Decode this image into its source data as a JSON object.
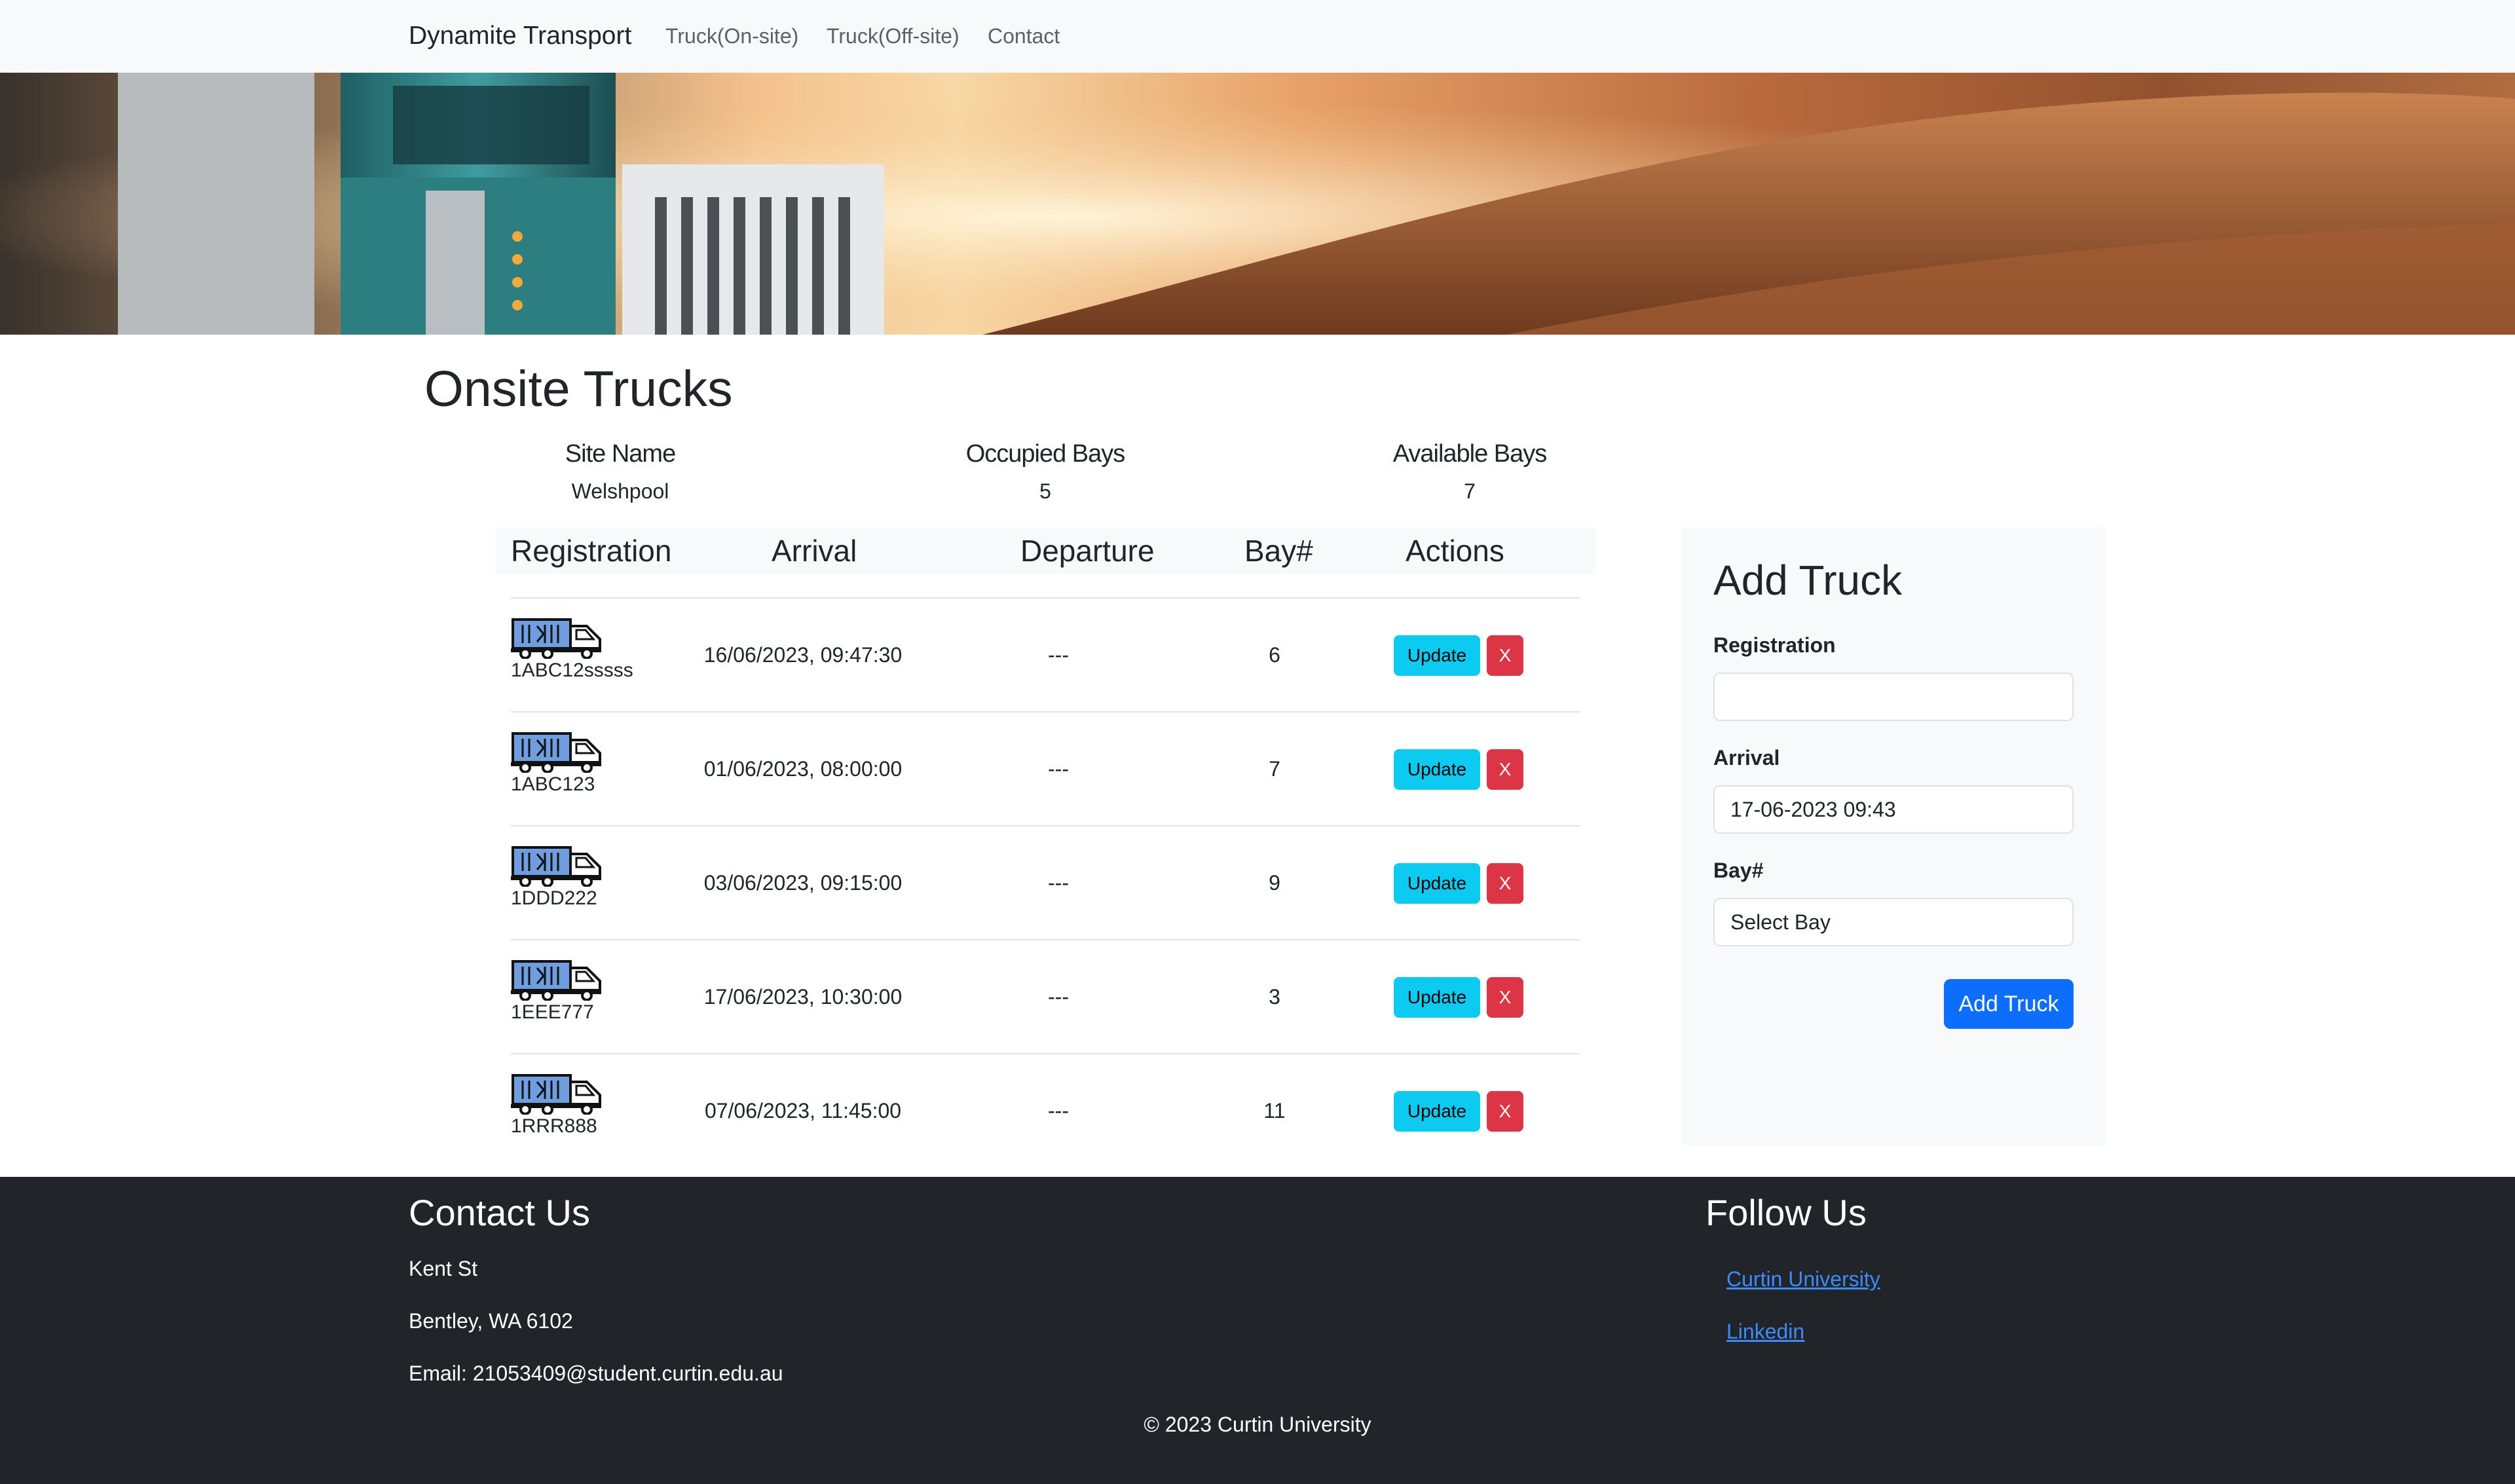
{
  "navbar": {
    "brand": "Dynamite Transport",
    "links": [
      "Truck(On-site)",
      "Truck(Off-site)",
      "Contact"
    ]
  },
  "hero": {
    "image": "truck-sunset-banner"
  },
  "main": {
    "title": "Onsite Trucks",
    "summary": {
      "site_name_label": "Site Name",
      "site_name": "Welshpool",
      "occupied_label": "Occupied Bays",
      "occupied": "5",
      "available_label": "Available Bays",
      "available": "7"
    },
    "table": {
      "headers": [
        "Registration",
        "Arrival",
        "Departure",
        "Bay#",
        "Actions"
      ],
      "update_label": "Update",
      "delete_label": "X",
      "rows": [
        {
          "registration": "1ABC12sssss",
          "arrival": "16/06/2023, 09:47:30",
          "departure": "---",
          "bay": "6"
        },
        {
          "registration": "1ABC123",
          "arrival": "01/06/2023, 08:00:00",
          "departure": "---",
          "bay": "7"
        },
        {
          "registration": "1DDD222",
          "arrival": "03/06/2023, 09:15:00",
          "departure": "---",
          "bay": "9"
        },
        {
          "registration": "1EEE777",
          "arrival": "17/06/2023, 10:30:00",
          "departure": "---",
          "bay": "3"
        },
        {
          "registration": "1RRR888",
          "arrival": "07/06/2023, 11:45:00",
          "departure": "---",
          "bay": "11"
        }
      ]
    }
  },
  "add_truck": {
    "title": "Add Truck",
    "registration_label": "Registration",
    "registration_value": "",
    "arrival_label": "Arrival",
    "arrival_value": "17-06-2023 09:43",
    "bay_label": "Bay#",
    "bay_value": "Select Bay",
    "submit_label": "Add Truck"
  },
  "footer": {
    "contact_title": "Contact Us",
    "address_line1": "Kent St",
    "address_line2": "Bentley, WA 6102",
    "email": "Email: 21053409@student.curtin.edu.au",
    "follow_title": "Follow Us",
    "links": [
      "Curtin University",
      "Linkedin"
    ],
    "copyright": "© 2023 Curtin University"
  },
  "colors": {
    "navbar_bg": "#f8f9fa",
    "footer_bg": "#212529",
    "update_button": "#0dcaf0",
    "delete_button": "#dc3545",
    "primary_button": "#0d6efd",
    "link": "#3d8bfd"
  }
}
